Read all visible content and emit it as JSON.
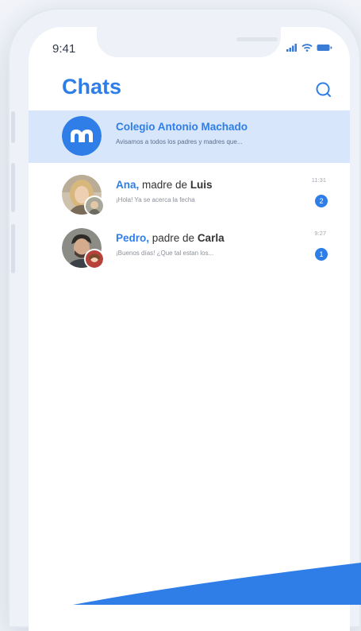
{
  "status_bar": {
    "time": "9:41"
  },
  "header": {
    "title": "Chats"
  },
  "chats": [
    {
      "name": "Colegio Antonio Machado",
      "preview": "Avisamos a todos los padres y madres que...",
      "time": "",
      "badge": ""
    },
    {
      "name_part1": "Ana,",
      "name_part2": " madre de ",
      "name_part3": "Luis",
      "preview": "¡Hola! Ya se acerca la fecha",
      "time": "11:31",
      "badge": "2"
    },
    {
      "name_part1": "Pedro,",
      "name_part2": " padre de ",
      "name_part3": "Carla",
      "preview": "¡Buenos días! ¿Que tal estan los...",
      "time": "9:27",
      "badge": "1"
    }
  ],
  "colors": {
    "accent": "#2f7ee8",
    "highlight": "#d7e6fb"
  }
}
